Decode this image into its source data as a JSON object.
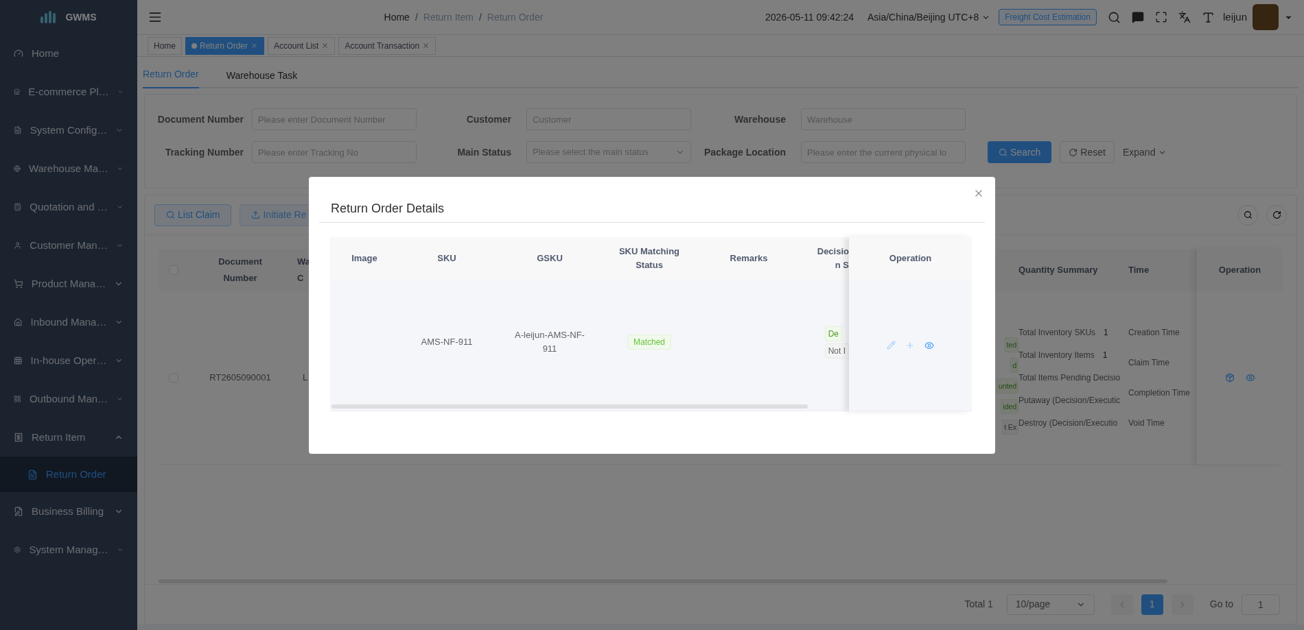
{
  "app": {
    "logo": "GWMS"
  },
  "sidebar": {
    "items": [
      {
        "label": "Home",
        "kind": "link",
        "selected": false
      },
      {
        "label": "E-commerce Pl…",
        "kind": "group",
        "expanded": false
      },
      {
        "label": "System Config…",
        "kind": "group",
        "expanded": false
      },
      {
        "label": "Warehouse Ma…",
        "kind": "group",
        "expanded": false
      },
      {
        "label": "Quotation and …",
        "kind": "group",
        "expanded": false
      },
      {
        "label": "Customer Man…",
        "kind": "group",
        "expanded": false
      },
      {
        "label": "Product Mana…",
        "kind": "group",
        "expanded": false
      },
      {
        "label": "Inbound Mana…",
        "kind": "group",
        "expanded": false
      },
      {
        "label": "In-house Oper…",
        "kind": "group",
        "expanded": false
      },
      {
        "label": "Outbound Man…",
        "kind": "group",
        "expanded": false
      },
      {
        "label": "Return Item",
        "kind": "group",
        "expanded": true,
        "children": [
          {
            "label": "Return Order",
            "selected": true
          }
        ]
      },
      {
        "label": "Business Billing",
        "kind": "group",
        "expanded": false
      },
      {
        "label": "System Manag…",
        "kind": "group",
        "expanded": false
      }
    ]
  },
  "header": {
    "breadcrumb": [
      "Home",
      "Return Item",
      "Return Order"
    ],
    "breadcrumb_separator": "/",
    "datetime": "2026-05-11 09:42:24",
    "timezone": "Asia/China/Beijing UTC+8",
    "freight_button": "Freight Cost Estimation",
    "user": "leijun"
  },
  "open_tabs": [
    {
      "label": "Home",
      "selected": false,
      "closable": false
    },
    {
      "label": "Return Order",
      "selected": true,
      "closable": true
    },
    {
      "label": "Account List",
      "selected": false,
      "closable": true
    },
    {
      "label": "Account Transaction",
      "selected": false,
      "closable": true
    }
  ],
  "page_tabs": [
    {
      "label": "Return Order",
      "selected": true
    },
    {
      "label": "Warehouse Task",
      "selected": false
    }
  ],
  "filters": [
    {
      "label": "Document Number",
      "placeholder": "Please enter Document Number",
      "kind": "input"
    },
    {
      "label": "Customer",
      "placeholder": "Customer",
      "kind": "input"
    },
    {
      "label": "Warehouse",
      "placeholder": "Warehouse",
      "kind": "input"
    },
    {
      "label": "Tracking Number",
      "placeholder": "Please enter Tracking No",
      "kind": "input"
    },
    {
      "label": "Main Status",
      "placeholder": "Please select the main status",
      "kind": "select"
    },
    {
      "label": "Package Location",
      "placeholder": "Please enter the current physical lo",
      "kind": "input"
    }
  ],
  "filter_buttons": {
    "search": "Search",
    "reset": "Reset",
    "expand": "Expand"
  },
  "toolbar": {
    "list_claim": "List Claim",
    "initiate": {
      "label": "Initiate Re",
      "disabled": true
    }
  },
  "table": {
    "select_all_checked": false,
    "columns": [
      [
        "Document",
        "Number"
      ],
      [
        "Wa",
        "C"
      ],
      [
        "Quantity Summary"
      ],
      [
        "Time"
      ],
      [
        "Operation"
      ]
    ],
    "rows": [
      {
        "checked": false,
        "document": "RT2605090001",
        "column_2": "L",
        "status_tags": [
          {
            "text": "ted",
            "kind": "success"
          },
          {
            "text": "d",
            "kind": "success"
          },
          {
            "text": "unted",
            "kind": "success"
          },
          {
            "text": "ided",
            "kind": "success"
          },
          {
            "text": "t Ex",
            "kind": "info"
          }
        ],
        "quantities": [
          {
            "label": "Total Inventory SKUs",
            "value": "1"
          },
          {
            "label": "Total Inventory Items",
            "value": "1"
          },
          {
            "label": "Total Items Pending Decisio"
          },
          {
            "label": "Putaway (Decision/Executic"
          },
          {
            "label": "Destroy (Decision/Executio"
          }
        ],
        "times": [
          "Creation Time",
          "Claim Time",
          "Completion Time",
          "Void Time"
        ]
      }
    ]
  },
  "pagination": {
    "total": "Total 1",
    "page_size": "10/page",
    "pages": [
      {
        "label": "1",
        "selected": true
      }
    ],
    "goto_label": "Go to",
    "goto_value": "1"
  },
  "modal": {
    "title": "Return Order Details",
    "columns": [
      [
        "Image"
      ],
      [
        "SKU"
      ],
      [
        "GSKU"
      ],
      [
        "SKU Matching",
        "Status"
      ],
      [
        "Remarks"
      ],
      [
        "Decisio",
        "n S"
      ],
      [
        "Operation"
      ]
    ],
    "rows": [
      {
        "sku": "AMS-NF-911",
        "gsku": "A-leijun-AMS-NF-911",
        "matching": "Matched",
        "decision_tags": [
          {
            "text": "De",
            "kind": "success"
          },
          {
            "text": "Not I",
            "kind": "info"
          }
        ]
      }
    ]
  }
}
